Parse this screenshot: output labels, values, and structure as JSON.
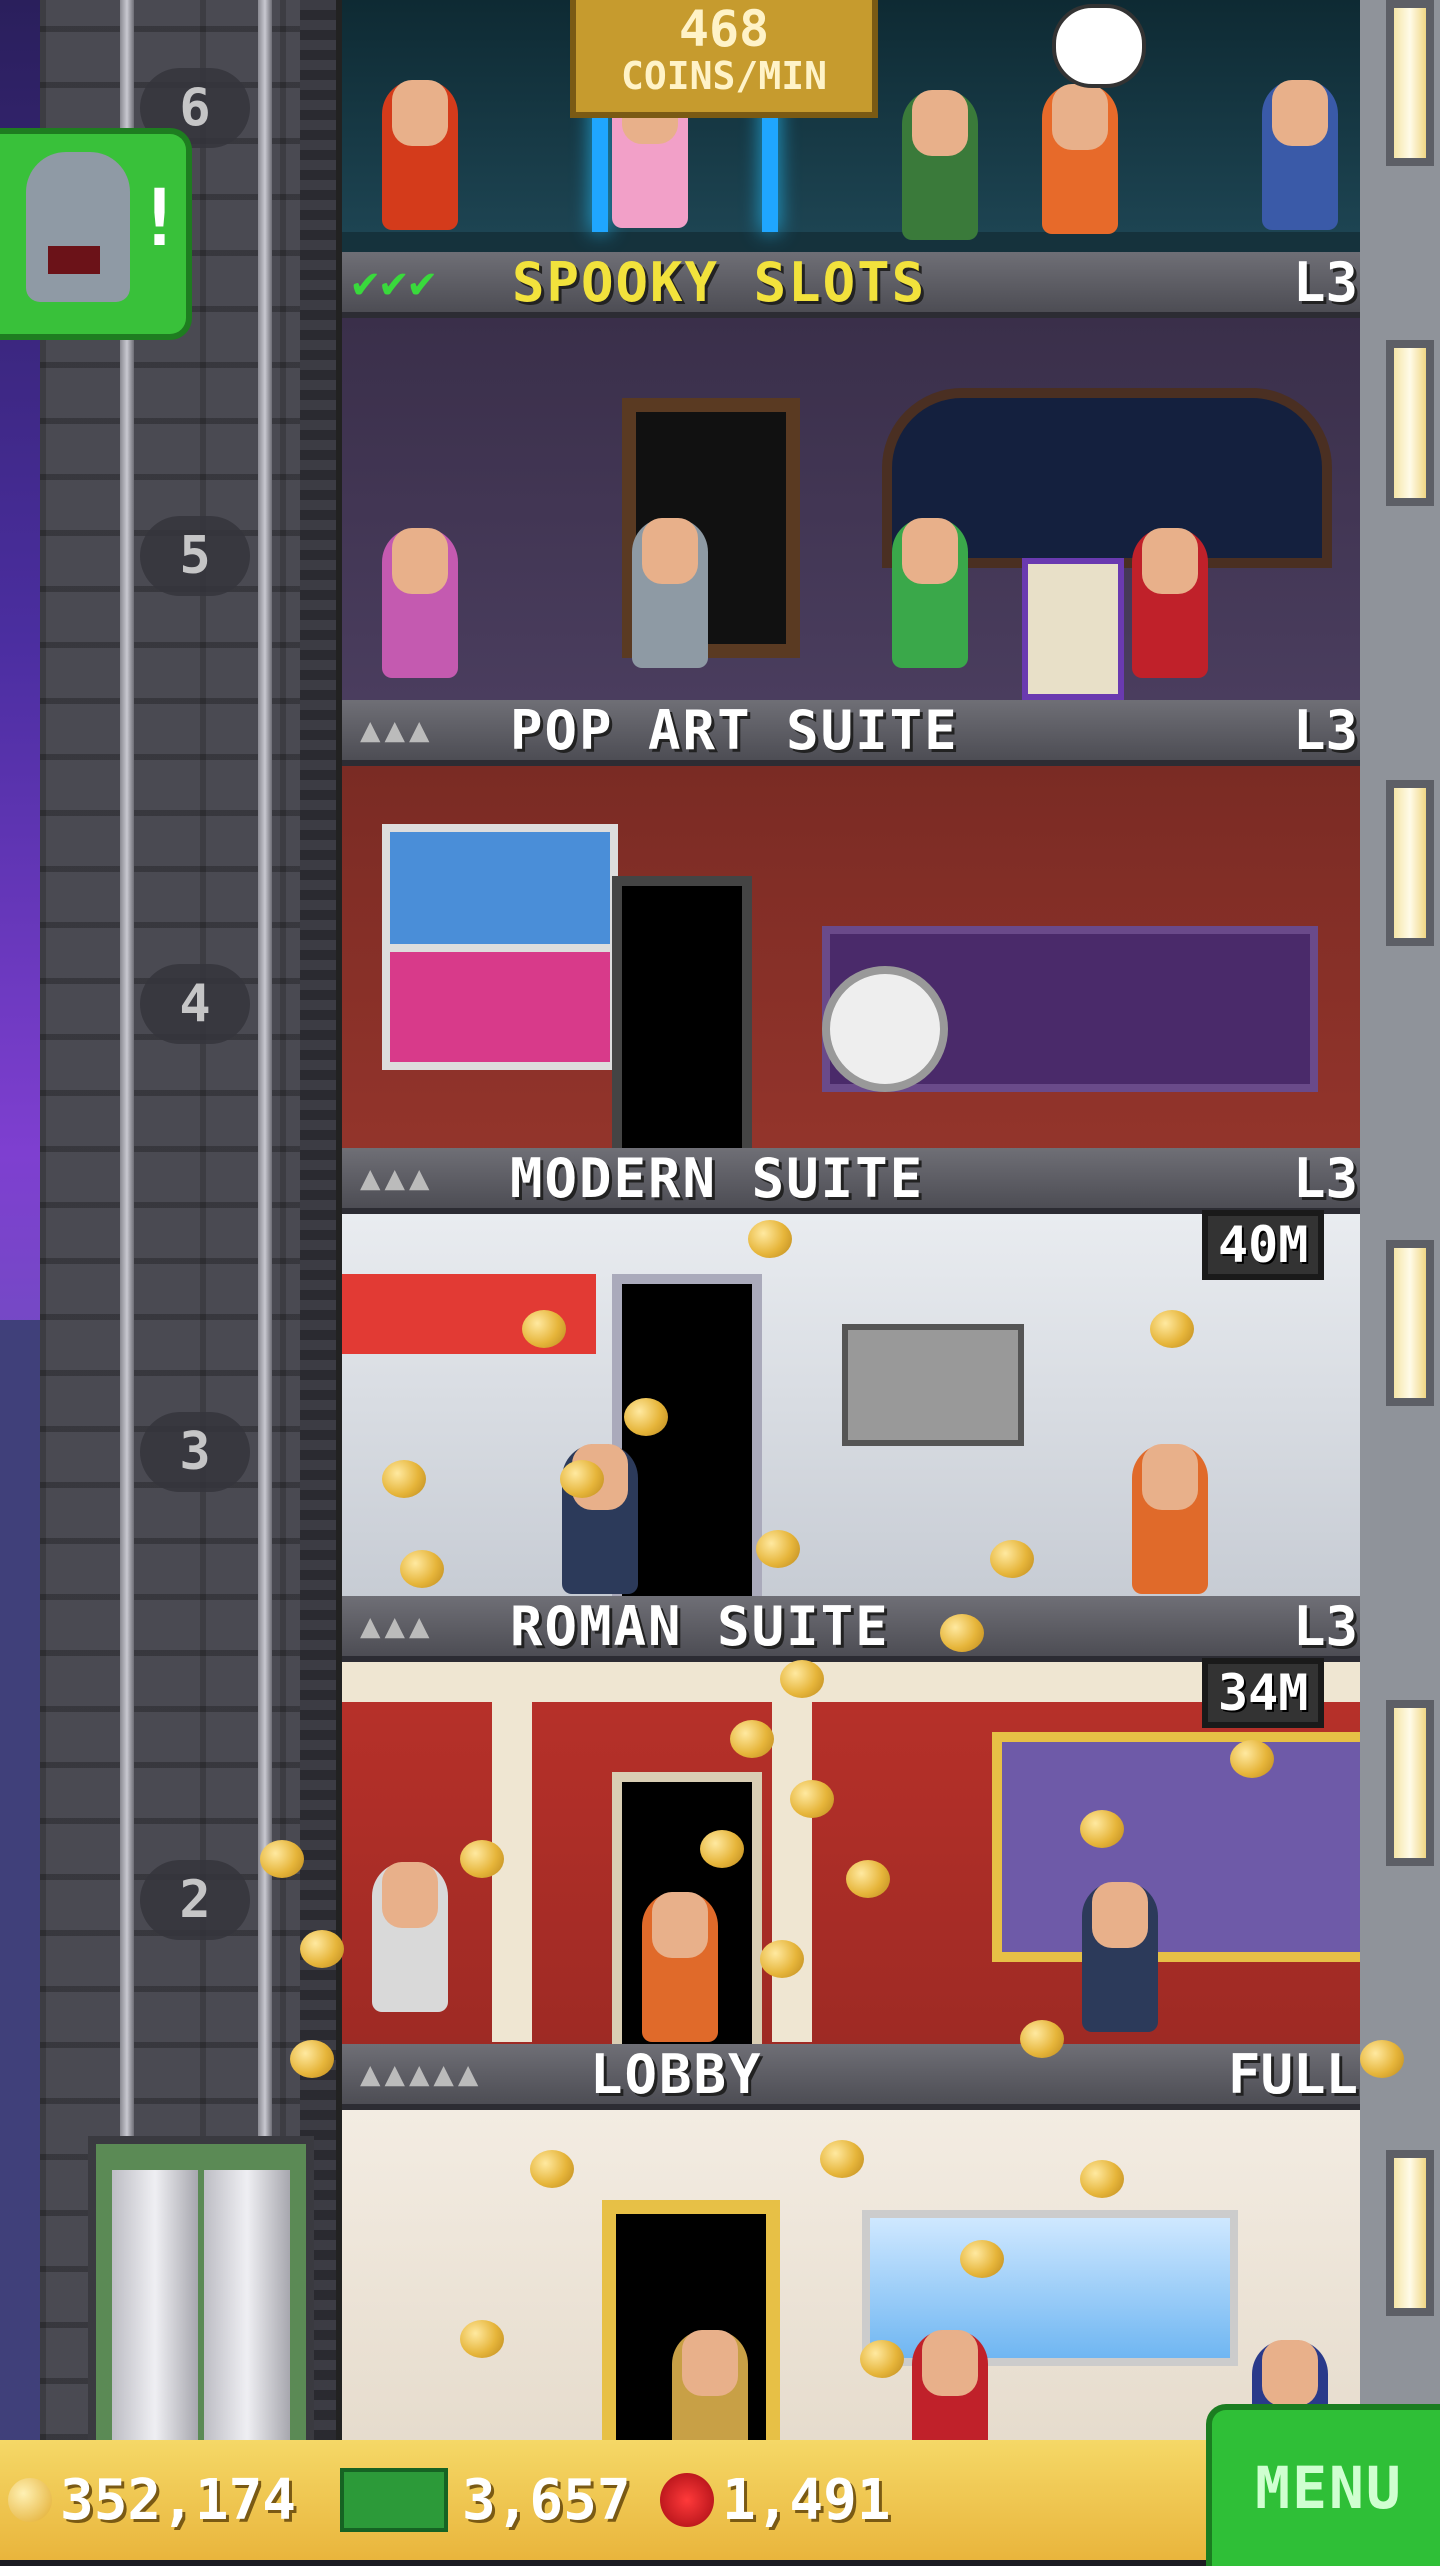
{
  "income": {
    "value": "468",
    "unit": "COINS/MIN"
  },
  "elevator": {
    "floor_numbers": [
      "6",
      "5",
      "4",
      "3",
      "2"
    ]
  },
  "floors": [
    {
      "name": "SPOOKY SLOTS",
      "level": "L3",
      "stocked": 3
    },
    {
      "name": "POP ART SUITE",
      "level": "L3",
      "people": "▲▲▲"
    },
    {
      "name": "MODERN SUITE",
      "level": "L3",
      "people": "▲▲▲",
      "rent_badge": "40M"
    },
    {
      "name": "ROMAN SUITE",
      "level": "L3",
      "people": "▲▲▲",
      "rent_badge": "34M"
    },
    {
      "name": "LOBBY",
      "level": "FULL",
      "people": "▲▲▲▲▲"
    }
  ],
  "status_bar": {
    "coins": "352,174",
    "bux": "3,657",
    "keys": "1,491",
    "menu_label": "MENU"
  },
  "colors": {
    "gold": "#e9b53c",
    "menu_green": "#2fbf37",
    "check_green": "#39d93c",
    "spooky_title": "#f2e23c"
  }
}
